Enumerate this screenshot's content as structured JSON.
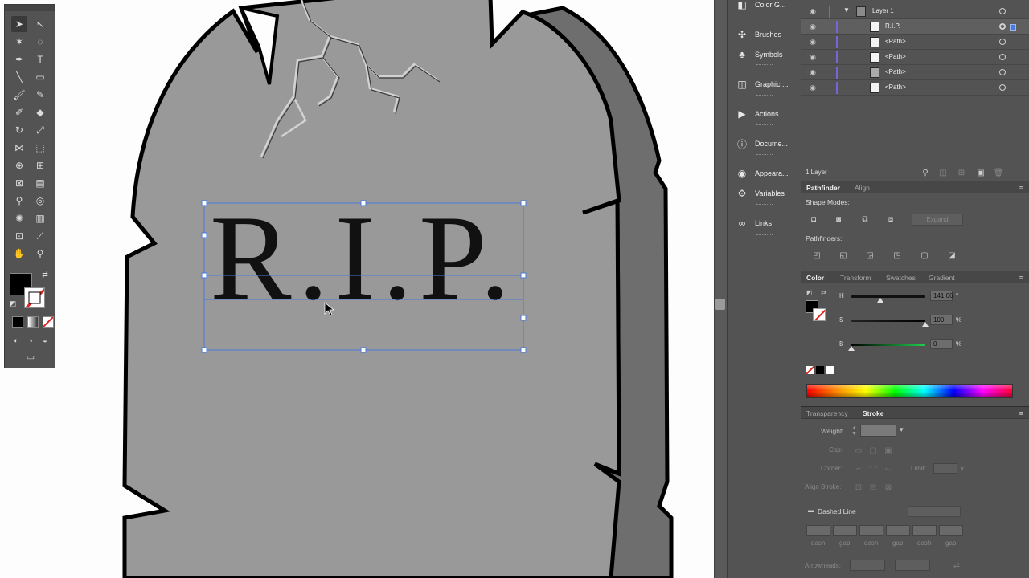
{
  "canvas": {
    "artwork_text": "R.I.P.",
    "stone_color": "#999999",
    "stone_side_color": "#6e6e6e",
    "outline_color": "#000000"
  },
  "toolbar": {
    "tools": [
      "selection-tool",
      "direct-selection-tool",
      "magic-wand-tool",
      "lasso-tool",
      "pen-tool",
      "type-tool",
      "line-tool",
      "rectangle-tool",
      "paintbrush-tool",
      "pencil-tool",
      "blob-brush-tool",
      "eraser-tool",
      "rotate-tool",
      "scale-tool",
      "width-tool",
      "free-transform-tool",
      "shape-builder-tool",
      "perspective-grid-tool",
      "mesh-tool",
      "gradient-tool",
      "eyedropper-tool",
      "blend-tool",
      "symbol-sprayer-tool",
      "column-graph-tool",
      "artboard-tool",
      "slice-tool",
      "hand-tool",
      "zoom-tool"
    ],
    "fill_color": "#000000"
  },
  "dock": {
    "items": [
      {
        "label": "Color G...",
        "icon": "color-guide-icon"
      },
      {
        "label": "Brushes",
        "icon": "brushes-icon"
      },
      {
        "label": "Symbols",
        "icon": "symbols-icon"
      },
      {
        "label": "Graphic ...",
        "icon": "graphic-styles-icon"
      },
      {
        "label": "Actions",
        "icon": "actions-icon"
      },
      {
        "label": "Docume...",
        "icon": "document-info-icon"
      },
      {
        "label": "Appeara...",
        "icon": "appearance-icon"
      },
      {
        "label": "Variables",
        "icon": "variables-icon"
      },
      {
        "label": "Links",
        "icon": "links-icon"
      }
    ]
  },
  "layers": {
    "layer_name": "Layer 1",
    "rows": [
      {
        "name": "R.I.P."
      },
      {
        "name": "<Path>"
      },
      {
        "name": "<Path>"
      },
      {
        "name": "<Path>"
      },
      {
        "name": "<Path>"
      }
    ],
    "count_label": "1 Layer"
  },
  "pathfinder": {
    "tabs": [
      "Pathfinder",
      "Align"
    ],
    "shape_modes_label": "Shape Modes:",
    "expand_label": "Expand",
    "pathfinders_label": "Pathfinders:"
  },
  "color": {
    "tabs": [
      "Color",
      "Transform",
      "Swatches",
      "Gradient"
    ],
    "h_label": "H",
    "h_value": "141,06",
    "h_unit": "°",
    "s_label": "S",
    "s_value": "100",
    "s_unit": "%",
    "b_label": "B",
    "b_value": "0",
    "b_unit": "%",
    "h_level": 0.39,
    "s_level": 1.0,
    "b_level": 0.0
  },
  "stroke": {
    "tabs": [
      "Transparency",
      "Stroke"
    ],
    "weight_label": "Weight:",
    "cap_label": "Cap:",
    "corner_label": "Corner:",
    "limit_label": "Limit:",
    "limit_unit": "x",
    "align_label": "Align Stroke:",
    "dashed_label": "Dashed Line",
    "dash_labels": [
      "dash",
      "gap",
      "dash",
      "gap",
      "dash",
      "gap"
    ],
    "arrowheads_label": "Arrowheads:"
  }
}
